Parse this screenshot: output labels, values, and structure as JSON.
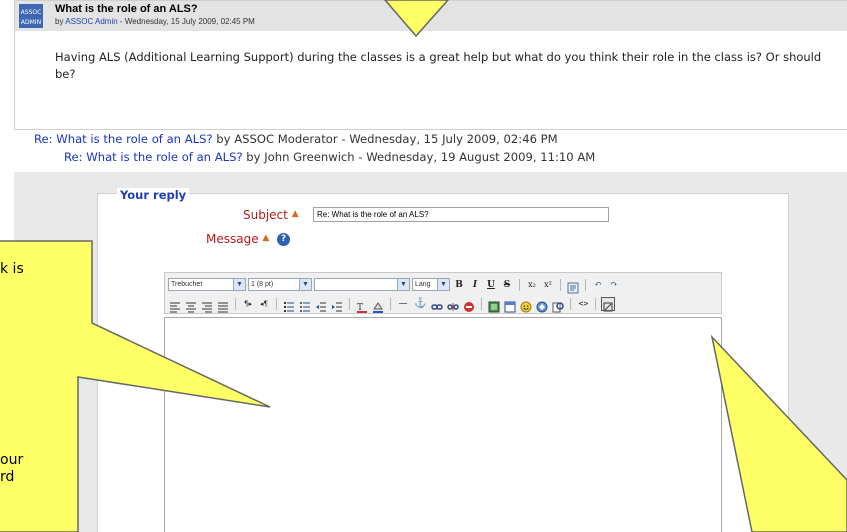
{
  "post": {
    "badge_line1": "ASSOC",
    "badge_line2": "ADMIN",
    "title": "What is the role of an ALS?",
    "meta_prefix": "by ",
    "author": "ASSOC Admin",
    "meta_suffix": " - Wednesday, 15 July 2009, 02:45 PM",
    "body": "Having ALS (Additional Learning Support) during the classes is a great help but what do you think their role in the class is?  Or should be?"
  },
  "replies": [
    {
      "link": "Re: What is the role of an ALS?",
      "rest": " by ASSOC Moderator - Wednesday, 15 July 2009, 02:46 PM"
    },
    {
      "link": "Re: What is the role of an ALS?",
      "rest": " by John Greenwich - Wednesday, 19 August 2009, 11:10 AM"
    }
  ],
  "form": {
    "legend": "Your reply",
    "subject_label": "Subject",
    "message_label": "Message",
    "required_mark": "▲",
    "help_icon": "?",
    "subject_value": "Re: What is the role of an ALS?"
  },
  "toolbar": {
    "font_family": "Trebuchet",
    "font_size": "1 (8 pt)",
    "style": "",
    "lang": "Lang",
    "bold": "B",
    "italic": "I",
    "underline": "U",
    "strike": "S",
    "subscript": "x₂",
    "superscript": "x²",
    "undo": "↶",
    "redo": "↷",
    "ltr": "¶▸",
    "rtl": "◂¶",
    "hr": "—",
    "anchor": "⚓",
    "html_source": "<>",
    "dropdown_arrow": "▼"
  },
  "callouts": {
    "left_line1": "k is",
    "left_line2": "our",
    "left_line3": "rd"
  },
  "colors": {
    "callout_fill": "#ffff66",
    "callout_stroke": "#666666",
    "link": "#1b33c7",
    "required": "#b21a1a"
  }
}
